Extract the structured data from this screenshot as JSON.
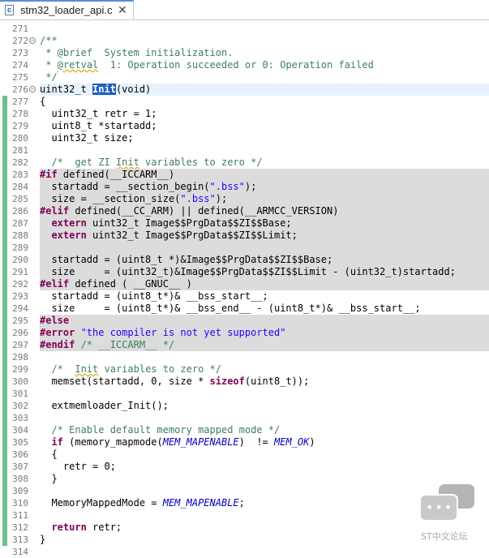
{
  "tab": {
    "filename": "stm32_loader_api.c",
    "file_icon_letter": "c",
    "close_glyph": "✕"
  },
  "code_lines": [
    {
      "n": "271"
    },
    {
      "n": "272",
      "fold": true
    },
    {
      "n": "273"
    },
    {
      "n": "274"
    },
    {
      "n": "275"
    },
    {
      "n": "276",
      "fold": true
    },
    {
      "n": "277"
    },
    {
      "n": "278"
    },
    {
      "n": "279"
    },
    {
      "n": "280"
    },
    {
      "n": "281"
    },
    {
      "n": "282"
    },
    {
      "n": "283"
    },
    {
      "n": "284"
    },
    {
      "n": "285"
    },
    {
      "n": "286"
    },
    {
      "n": "287"
    },
    {
      "n": "288"
    },
    {
      "n": "289"
    },
    {
      "n": "290"
    },
    {
      "n": "291"
    },
    {
      "n": "292"
    },
    {
      "n": "293"
    },
    {
      "n": "294"
    },
    {
      "n": "295"
    },
    {
      "n": "296"
    },
    {
      "n": "297"
    },
    {
      "n": "298"
    },
    {
      "n": "299"
    },
    {
      "n": "300"
    },
    {
      "n": "301"
    },
    {
      "n": "302"
    },
    {
      "n": "303"
    },
    {
      "n": "304"
    },
    {
      "n": "305"
    },
    {
      "n": "306"
    },
    {
      "n": "307"
    },
    {
      "n": "308"
    },
    {
      "n": "309"
    },
    {
      "n": "310"
    },
    {
      "n": "311"
    },
    {
      "n": "312"
    },
    {
      "n": "313"
    },
    {
      "n": "314"
    }
  ],
  "code": {
    "l271": "",
    "l272": "/**",
    "l273a": " * @brief  System initialization.",
    "l274a": " * ",
    "l274b": "@retval",
    "l274c": "  1: Operation succeeded or 0: Operation failed",
    "l275": " */",
    "l276a": "uint32_t ",
    "l276b": "Init",
    "l276c": "(void)",
    "l277": "{",
    "l278": "  uint32_t retr = 1;",
    "l279": "  uint8_t *startadd;",
    "l280": "  uint32_t size;",
    "l281": "",
    "l282a": "  /*  get ZI ",
    "l282b": "Init",
    "l282c": " variables to zero */",
    "l283a": "#if",
    "l283b": " defined(__ICCARM__)",
    "l284a": "  startadd = __section_begin(",
    "l284b": "\".bss\"",
    "l284c": ");",
    "l285a": "  size = __section_size(",
    "l285b": "\".bss\"",
    "l285c": ");",
    "l286a": "#elif",
    "l286b": " defined(__CC_ARM) || defined(__ARMCC_VERSION)",
    "l287a": "  extern",
    "l287b": " uint32_t Image$$PrgData$$ZI$$Base;",
    "l288a": "  extern",
    "l288b": " uint32_t Image$$PrgData$$ZI$$Limit;",
    "l289": "",
    "l290": "  startadd = (uint8_t *)&Image$$PrgData$$ZI$$Base;",
    "l291": "  size     = (uint32_t)&Image$$PrgData$$ZI$$Limit - (uint32_t)startadd;",
    "l292a": "#elif",
    "l292b": " defined ( __GNUC__ )",
    "l293": "  startadd = (uint8_t*)& __bss_start__;",
    "l294": "  size     = (uint8_t*)& __bss_end__ - (uint8_t*)& __bss_start__;",
    "l295": "#else",
    "l296a": "#error",
    "l296b": " \"the compiler is not yet supported\"",
    "l297a": "#endif",
    "l297b": " /* __ICCARM__ */",
    "l298": "",
    "l299a": "  /*  ",
    "l299b": "Init",
    "l299c": " variables to zero */",
    "l300a": "  memset(startadd, 0, size * ",
    "l300b": "sizeof",
    "l300c": "(uint8_t));",
    "l301": "",
    "l302": "  extmemloader_Init();",
    "l303": "",
    "l304": "  /* Enable default memory mapped mode */",
    "l305a": "  if",
    "l305b": " (memory_mapmode(",
    "l305c": "MEM_MAPENABLE",
    "l305d": ")  != ",
    "l305e": "MEM_OK",
    "l305f": ")",
    "l306": "  {",
    "l307": "    retr = 0;",
    "l308": "  }",
    "l309": "",
    "l310a": "  MemoryMappedMode = ",
    "l310b": "MEM_MAPENABLE",
    "l310c": ";",
    "l311": "",
    "l312a": "  return",
    "l312b": " retr;",
    "l313": "}",
    "l314": ""
  },
  "watermark": {
    "text": "ST中文论坛",
    "dots": "•••"
  },
  "colors": {
    "keyword": "#7f0055",
    "comment": "#3f7f5f",
    "string": "#2a00ff",
    "macro": "#0000c0",
    "inactive_bg": "#dcdcdc",
    "quickdiff": "#6ec08e"
  }
}
